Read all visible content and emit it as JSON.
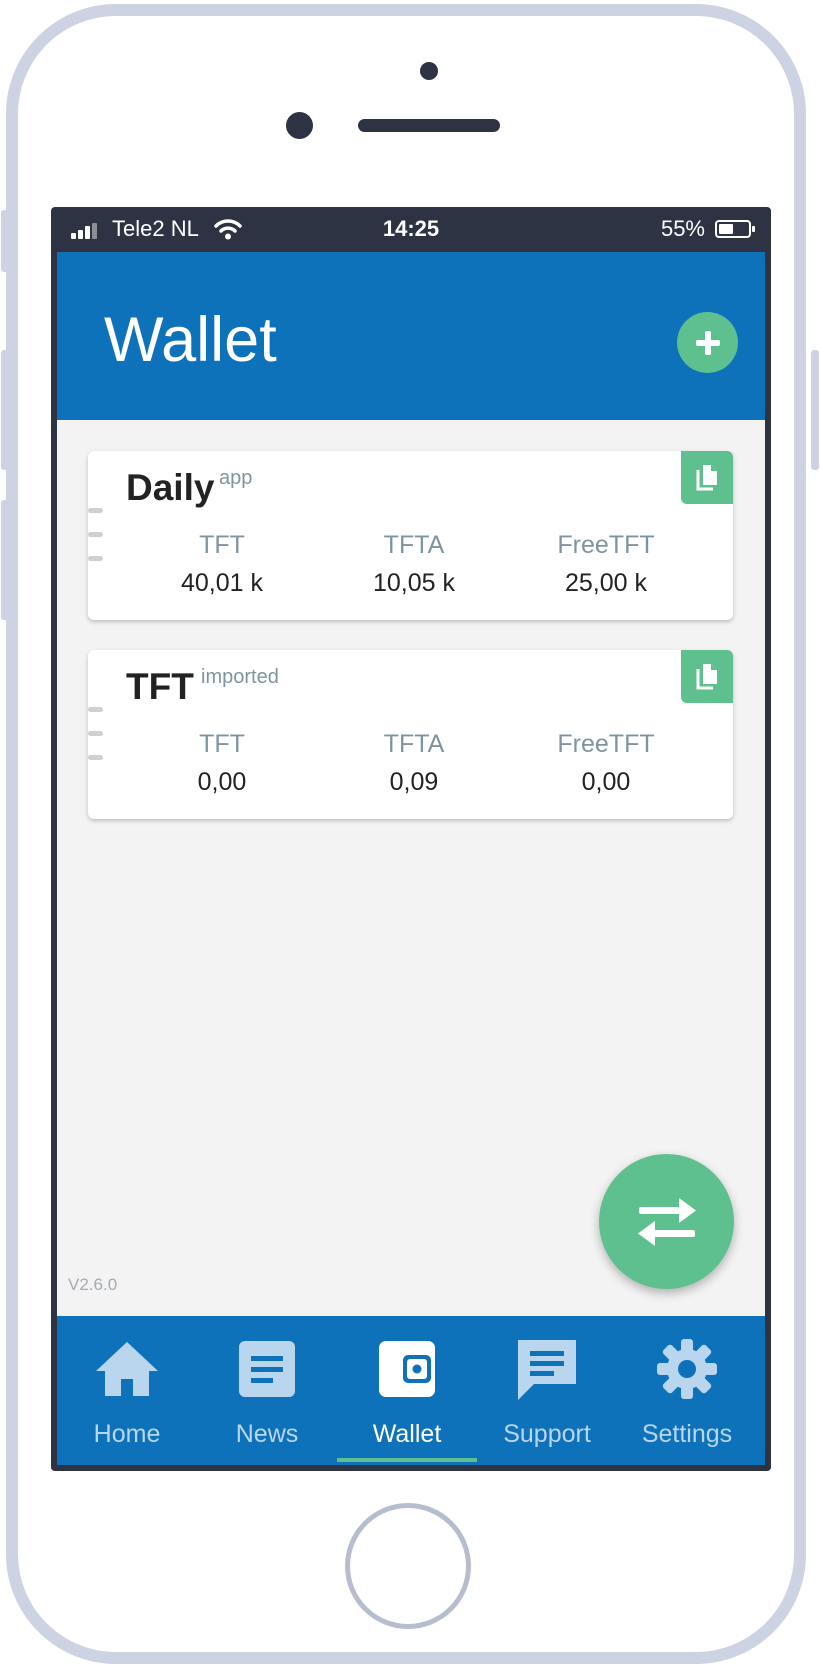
{
  "status_bar": {
    "carrier": "Tele2 NL",
    "time": "14:25",
    "battery_percent": "55%",
    "battery_level": 0.55
  },
  "header": {
    "title": "Wallet",
    "add_icon": "plus-icon"
  },
  "wallets": [
    {
      "name": "Daily",
      "tag": "app",
      "balances": [
        {
          "label": "TFT",
          "value": "40,01 k"
        },
        {
          "label": "TFTA",
          "value": "10,05 k"
        },
        {
          "label": "FreeTFT",
          "value": "25,00 k"
        }
      ]
    },
    {
      "name": "TFT",
      "tag": "imported",
      "balances": [
        {
          "label": "TFT",
          "value": "0,00"
        },
        {
          "label": "TFTA",
          "value": "0,09"
        },
        {
          "label": "FreeTFT",
          "value": "0,00"
        }
      ]
    }
  ],
  "version": "V2.6.0",
  "transfer_icon": "transfer-arrows-icon",
  "nav": [
    {
      "label": "Home",
      "icon": "home-icon"
    },
    {
      "label": "News",
      "icon": "news-icon"
    },
    {
      "label": "Wallet",
      "icon": "wallet-icon",
      "active": true
    },
    {
      "label": "Support",
      "icon": "chat-icon"
    },
    {
      "label": "Settings",
      "icon": "gear-icon"
    }
  ],
  "colors": {
    "primary": "#0e72ba",
    "accent": "#5ec08e",
    "status_bar": "#2e3344",
    "background": "#f3f3f3"
  }
}
